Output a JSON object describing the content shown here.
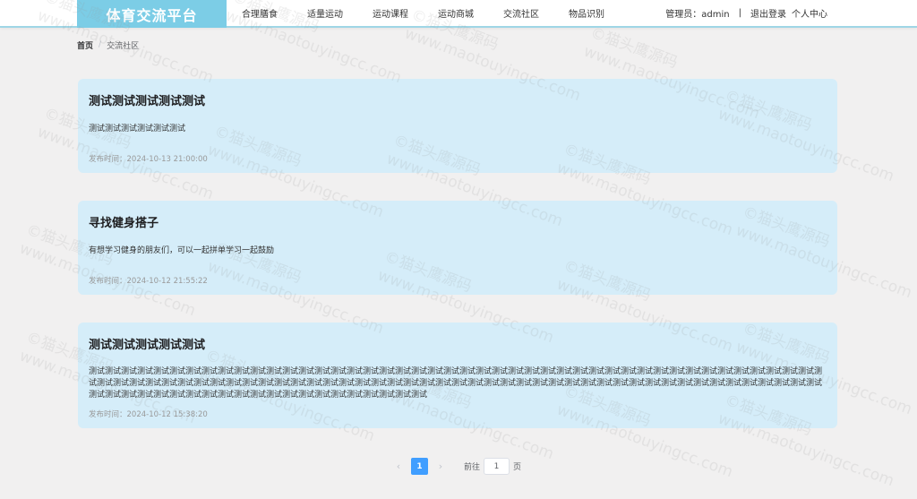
{
  "header": {
    "logo": "体育交流平台",
    "nav": [
      "合理膳食",
      "适量运动",
      "运动课程",
      "运动商城",
      "交流社区",
      "物品识别"
    ],
    "user_label": "管理员：admin",
    "separator": "|",
    "logout": "退出登录",
    "profile": "个人中心"
  },
  "breadcrumb": {
    "home": "首页",
    "sep": "/",
    "current": "交流社区"
  },
  "posts": [
    {
      "title": "测试测试测试测试测试",
      "content": "测试测试测试测试测试测试",
      "time": "发布时间：2024-10-13 21:00:00"
    },
    {
      "title": "寻找健身搭子",
      "content": "有想学习健身的朋友们，可以一起拼单学习一起鼓励",
      "time": "发布时间：2024-10-12 21:55:22"
    },
    {
      "title": "测试测试测试测试测试",
      "content": "测试测试测试测试测试测试测试测试测试测试测试测试测试测试测试测试测试测试测试测试测试测试测试测试测试测试测试测试测试测试测试测试测试测试测试测试测试测试测试测试测试测试测试测试测试测试测试测试测试测试测试测试测试测试测试测试测试测试测试测试测试测试测试测试测试测试测试测试测试测试测试测试测试测试测试测试测试测试测试测试测试测试测试测试测试测试测试测试测试测试测试测试测试测试测试测试测试测试测试测试测试测试测试测试测试测试测试测试测试测试测试测试",
      "time": "发布时间：2024-10-12 15:38:20"
    }
  ],
  "pagination": {
    "prev": "‹",
    "current": "1",
    "next": "›",
    "goto_label": "前往",
    "page_value": "1",
    "page_suffix": "页"
  },
  "watermark": {
    "line1": "©猫头鹰源码",
    "line2": "www.maotouyingcc.com"
  }
}
